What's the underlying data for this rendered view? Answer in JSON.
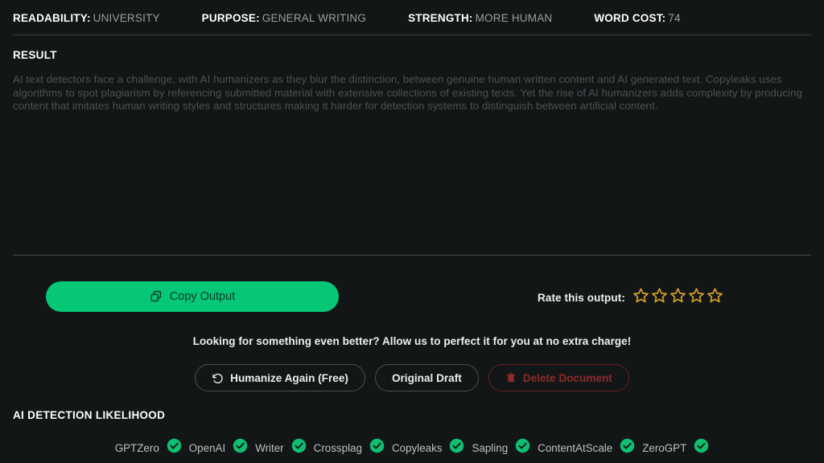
{
  "header": {
    "stats": [
      {
        "label": "READABILITY:",
        "value": "UNIVERSITY"
      },
      {
        "label": "PURPOSE:",
        "value": "GENERAL WRITING"
      },
      {
        "label": "STRENGTH:",
        "value": "MORE HUMAN"
      },
      {
        "label": "WORD COST:",
        "value": "74"
      }
    ]
  },
  "result": {
    "heading": "RESULT",
    "text": "AI text detectors face a challenge, with AI humanizers as they blur the distinction, between genuine human written content and AI generated text. Copyleaks uses algorithms to spot plagiarism by referencing submitted material with extensive collections of existing texts. Yet the rise of AI humanizers adds complexity by producing content that imitates human writing styles and structures making it harder for detection systems to distinguish between artificial content."
  },
  "actions": {
    "copy_label": "Copy Output",
    "copy_icon": "copy-icon",
    "copy_color": "#05c776",
    "rate_label": "Rate this output:",
    "star_count": 5,
    "stars_filled": 0,
    "star_color": "#d7a22a",
    "upsell": "Looking for something even better? Allow us to perfect it for you at no extra charge!",
    "buttons": [
      {
        "label": "Humanize Again (Free)",
        "icon": "history-undo-icon",
        "style": "default"
      },
      {
        "label": "Original Draft",
        "icon": "",
        "style": "default"
      },
      {
        "label": "Delete Document",
        "icon": "trash-icon",
        "style": "danger"
      }
    ]
  },
  "detection": {
    "heading": "AI DETECTION LIKELIHOOD",
    "badge_color": "#0fbf72",
    "detectors": [
      {
        "name": "GPTZero",
        "status": "pass"
      },
      {
        "name": "OpenAI",
        "status": "pass"
      },
      {
        "name": "Writer",
        "status": "pass"
      },
      {
        "name": "Crossplag",
        "status": "pass"
      },
      {
        "name": "Copyleaks",
        "status": "pass"
      },
      {
        "name": "Sapling",
        "status": "pass"
      },
      {
        "name": "ContentAtScale",
        "status": "pass"
      },
      {
        "name": "ZeroGPT",
        "status": "pass"
      }
    ]
  }
}
